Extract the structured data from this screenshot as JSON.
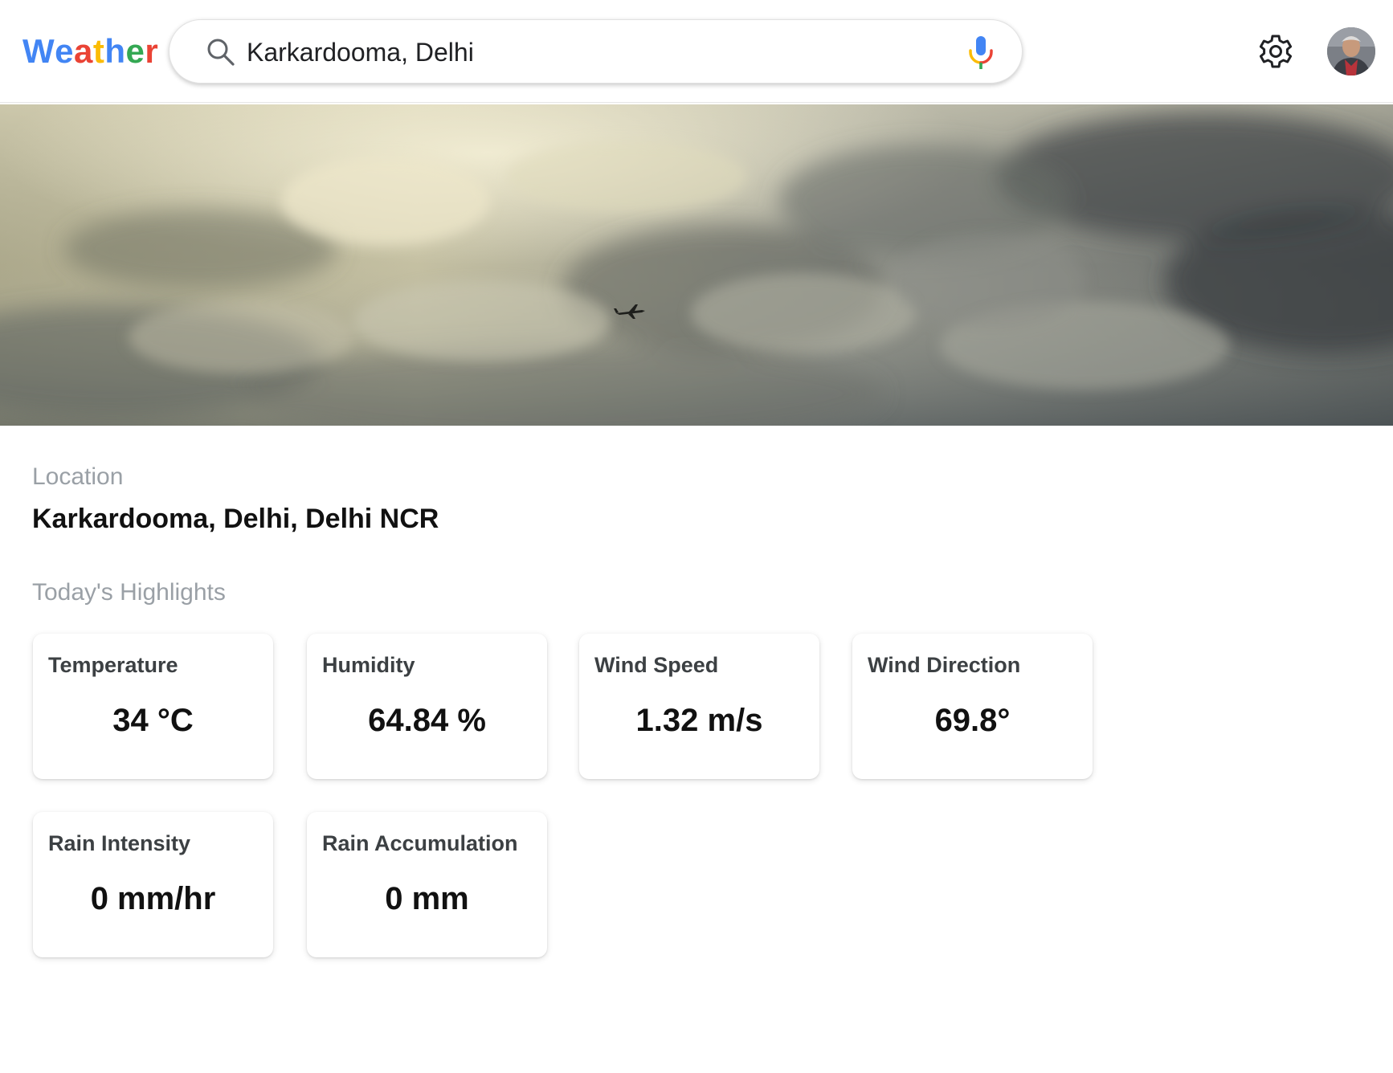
{
  "header": {
    "logo_letters": [
      {
        "char": "W",
        "color": "#4285F4"
      },
      {
        "char": "e",
        "color": "#4285F4"
      },
      {
        "char": "a",
        "color": "#EA4335"
      },
      {
        "char": "t",
        "color": "#FBBC05"
      },
      {
        "char": "h",
        "color": "#4285F4"
      },
      {
        "char": "e",
        "color": "#34A853"
      },
      {
        "char": "r",
        "color": "#EA4335"
      }
    ],
    "search_value": "Karkardooma, Delhi",
    "search_icon": "search-icon",
    "mic_icon": "mic-icon",
    "settings_icon": "gear-icon",
    "avatar_icon": "avatar"
  },
  "hero": {
    "image": "stormy-clouds-with-airplane"
  },
  "location": {
    "label": "Location",
    "value": "Karkardooma, Delhi, Delhi NCR"
  },
  "highlights": {
    "label": "Today's Highlights",
    "cards": [
      {
        "title": "Temperature",
        "value": "34 °C"
      },
      {
        "title": "Humidity",
        "value": "64.84 %"
      },
      {
        "title": "Wind Speed",
        "value": "1.32 m/s"
      },
      {
        "title": "Wind Direction",
        "value": "69.8°"
      },
      {
        "title": "Rain Intensity",
        "value": "0 mm/hr"
      },
      {
        "title": "Rain Accumulation",
        "value": "0 mm"
      }
    ]
  },
  "colors": {
    "google_blue": "#4285F4",
    "google_red": "#EA4335",
    "google_yellow": "#FBBC05",
    "google_green": "#34A853",
    "muted_label": "#9aa0a6"
  }
}
